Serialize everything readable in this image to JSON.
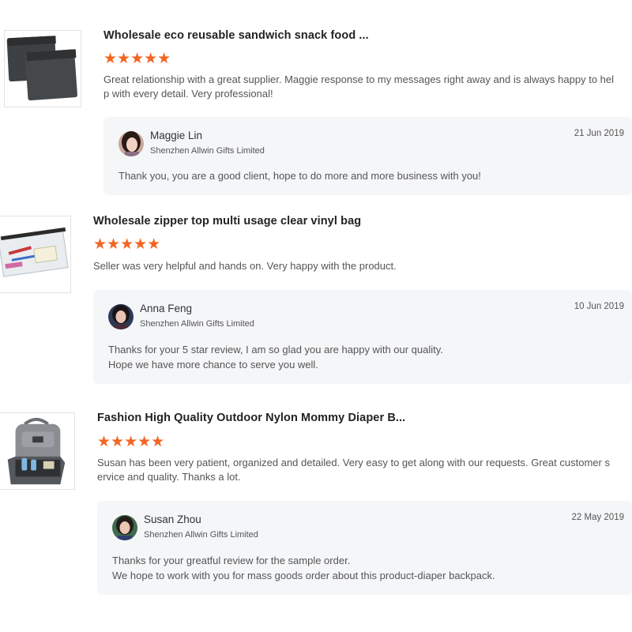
{
  "reviews": [
    {
      "product_title": "Wholesale eco reusable sandwich snack food ...",
      "stars": "★★★★★",
      "text": "Great relationship with a great supplier. Maggie response to my messages right away and is always happy to help with every detail. Very professional!",
      "reply": {
        "name": "Maggie Lin",
        "company": "Shenzhen Allwin Gifts Limited",
        "date": "21 Jun 2019",
        "message": "Thank you, you are a good client, hope to do more and more business with you!"
      }
    },
    {
      "product_title": "Wholesale zipper top multi usage clear vinyl bag",
      "stars": "★★★★★",
      "text": "Seller was very helpful and hands on. Very happy with the product.",
      "reply": {
        "name": "Anna Feng",
        "company": "Shenzhen Allwin Gifts Limited",
        "date": "10 Jun 2019",
        "message": "Thanks for your 5 star review, I am so glad you are happy with our quality.\nHope we have more chance to serve you well."
      }
    },
    {
      "product_title": "Fashion High Quality Outdoor Nylon Mommy Diaper B...",
      "stars": "★★★★★",
      "text": "Susan has been very patient, organized and detailed. Very easy to get along with our requests. Great customer service and quality. Thanks a lot.",
      "reply": {
        "name": "Susan Zhou",
        "company": "Shenzhen Allwin Gifts Limited",
        "date": "22 May 2019",
        "message": "Thanks for your greatful review for the sample order.\nWe hope to work with you for mass goods order about this product-diaper backpack."
      }
    }
  ],
  "colors": {
    "star": "#f26522",
    "reply_bg": "#f5f6f8"
  }
}
